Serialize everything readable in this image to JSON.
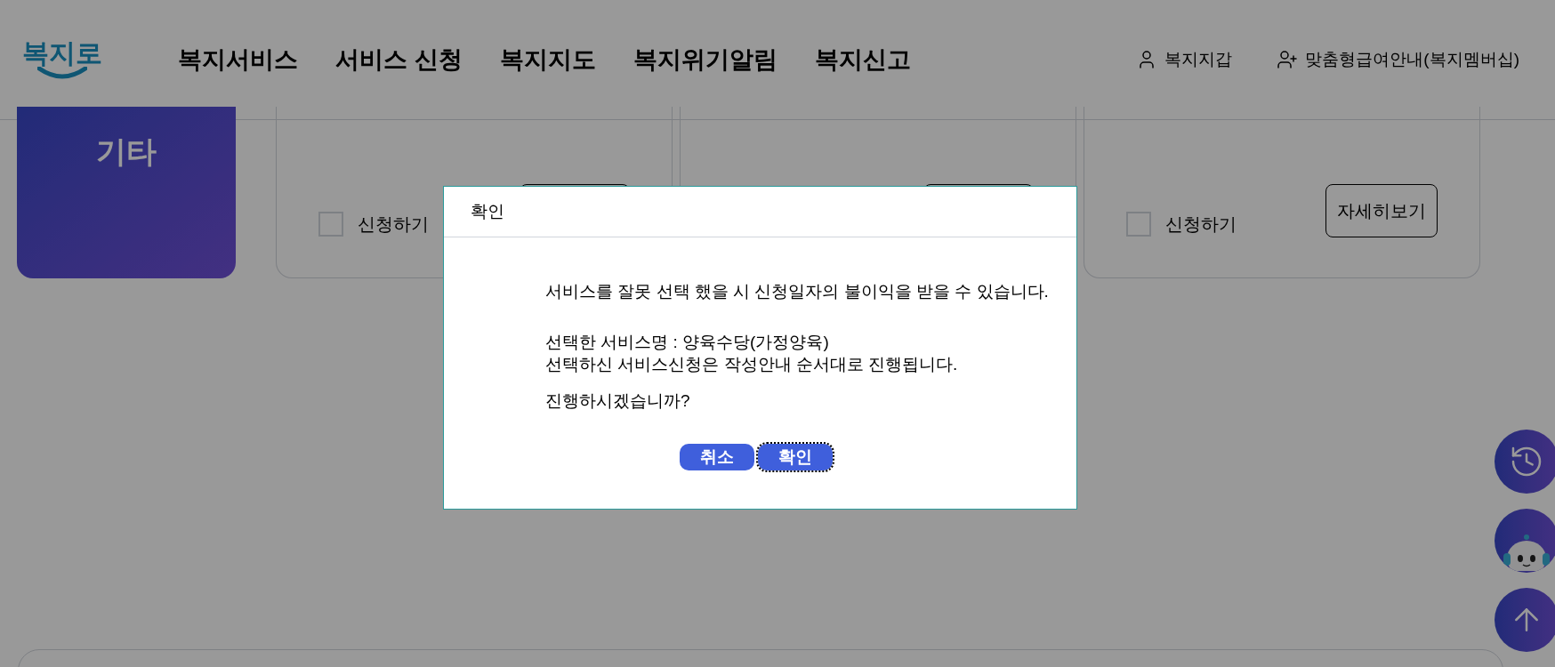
{
  "header": {
    "logo": "복지로",
    "nav": [
      "복지서비스",
      "서비스 신청",
      "복지지도",
      "복지위기알림",
      "복지신고"
    ],
    "utility": [
      {
        "kind": "person",
        "label": "복지지갑"
      },
      {
        "kind": "person-plus",
        "label": "맞춤형급여안내(복지멤버십)"
      }
    ]
  },
  "category_card": {
    "label": "기타"
  },
  "service_cards": [
    {
      "kind": "apply-only",
      "apply_label": "신청하기",
      "checked": false
    },
    {
      "kind": "covered"
    },
    {
      "kind": "full",
      "apply_label": "신청하기",
      "checked": false,
      "details_button": "자세히보기"
    }
  ],
  "dialog": {
    "title": "확인",
    "warning": "서비스를 잘못 선택 했을 시 신청일자의 불이익을 받을 수 있습니다.",
    "lines": [
      "선택한 서비스명 : 양육수당(가정양육)",
      "선택하신 서비스신청은 작성안내 순서대로 진행됩니다."
    ],
    "question": "진행하시겠습니까?",
    "buttons": [
      {
        "label": "취소",
        "focused": false
      },
      {
        "label": "확인",
        "focused": true
      }
    ]
  },
  "floating_buttons": [
    {
      "kind": "history"
    },
    {
      "kind": "chatbot"
    },
    {
      "kind": "top"
    }
  ]
}
